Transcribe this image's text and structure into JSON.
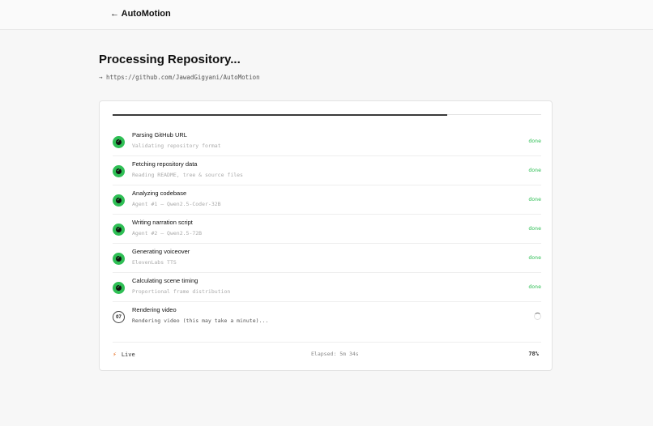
{
  "header": {
    "back_label": "← AutoMotion"
  },
  "main": {
    "title": "Processing Repository...",
    "repo_prefix": "→",
    "repo_url": "https://github.com/JawadGigyani/AutoMotion"
  },
  "progress": {
    "fraction": 0.78
  },
  "steps": [
    {
      "title": "Parsing GitHub URL",
      "subtitle": "Validating repository format",
      "status": "done"
    },
    {
      "title": "Fetching repository data",
      "subtitle": "Reading README, tree & source files",
      "status": "done"
    },
    {
      "title": "Analyzing codebase",
      "subtitle": "Agent #1 — Qwen2.5-Coder-32B",
      "status": "done"
    },
    {
      "title": "Writing narration script",
      "subtitle": "Agent #2 — Qwen2.5-72B",
      "status": "done"
    },
    {
      "title": "Generating voiceover",
      "subtitle": "ElevenLabs TTS",
      "status": "done"
    },
    {
      "title": "Calculating scene timing",
      "subtitle": "Proportional frame distribution",
      "status": "done"
    },
    {
      "title": "Rendering video",
      "subtitle": "Rendering video (this may take a minute)...",
      "badge": "07",
      "status": ""
    }
  ],
  "footer": {
    "live_label": "Live",
    "elapsed": "Elapsed: 5m 34s",
    "percent": "78%"
  },
  "colors": {
    "done": "#2fbf55",
    "live": "#e8742a"
  },
  "icons": {
    "back": "arrow-left-icon",
    "done": "check-icon",
    "live": "bolt-icon",
    "loading": "spinner-icon"
  }
}
